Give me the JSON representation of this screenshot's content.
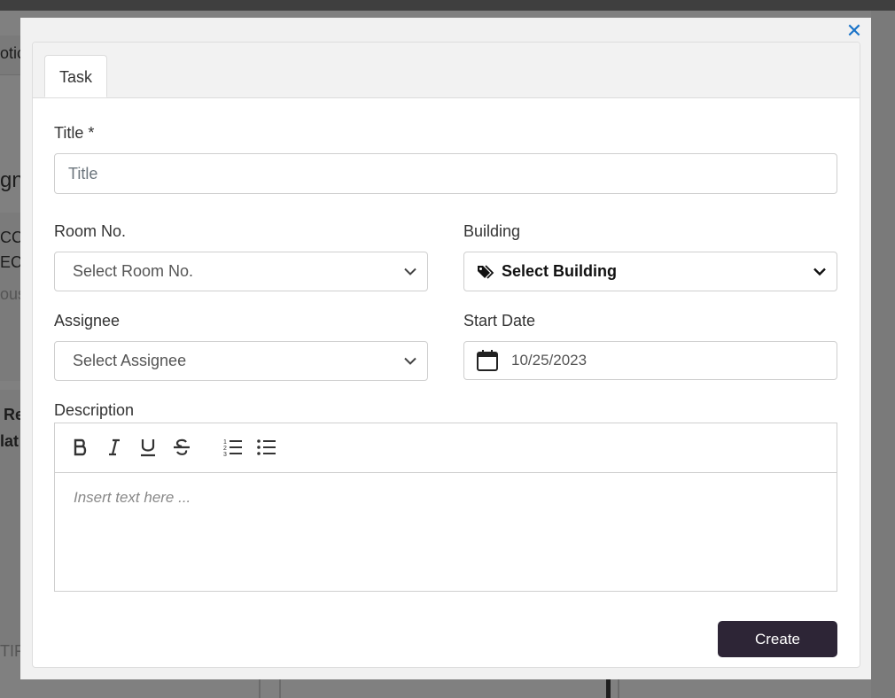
{
  "background": {
    "fragments": [
      "otic",
      "gn",
      "CC",
      "ECT",
      "ous",
      "Re",
      "lat",
      "TIF"
    ]
  },
  "modal": {
    "close_symbol": "✕",
    "tab_label": "Task",
    "title_label": "Title *",
    "title_placeholder": "Title",
    "room_label": "Room No.",
    "room_value": "Select Room No.",
    "building_label": "Building",
    "building_value": "Select Building",
    "assignee_label": "Assignee",
    "assignee_value": "Select Assignee",
    "start_date_label": "Start Date",
    "start_date_value": "10/25/2023",
    "description_label": "Description",
    "editor_placeholder": "Insert text here ...",
    "toolbar": [
      "bold",
      "italic",
      "underline",
      "strikethrough",
      "ordered-list",
      "bullet-list"
    ],
    "create_label": "Create"
  },
  "colors": {
    "accent": "#1a73c8",
    "create_button": "#2d2536"
  }
}
